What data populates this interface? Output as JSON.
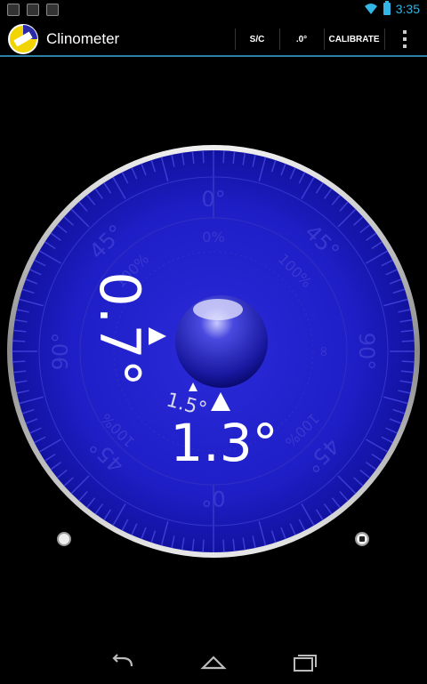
{
  "status_bar": {
    "time": "3:35"
  },
  "action_bar": {
    "title": "Clinometer",
    "sc_label": "S/C",
    "zero_label": ".0°",
    "calibrate_label": "CALIBRATE"
  },
  "dial": {
    "scale_labels": {
      "top_deg": "0°",
      "top_pct": "0%",
      "upper_left_deg": "45°",
      "upper_right_deg": "45°",
      "upper_left_pct": "100%",
      "upper_right_pct": "100%",
      "left_deg": "90°",
      "right_deg": "90°",
      "right_inner": "∞",
      "lower_left_pct": "100%",
      "lower_right_pct": "100%",
      "lower_left_deg": "45°",
      "lower_right_deg": "45°",
      "bottom_deg": "0°"
    },
    "readings": {
      "vertical_angle": "0.7°",
      "horizontal_angle": "1.3°",
      "small_reading": "1.5°"
    }
  },
  "colors": {
    "dial_blue": "#1f1fc8",
    "accent": "#33b5e5"
  }
}
